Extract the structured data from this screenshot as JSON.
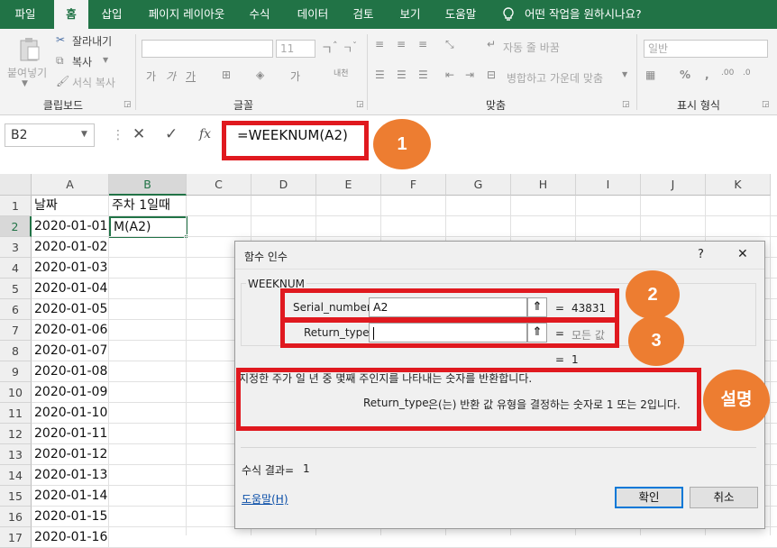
{
  "ribbon": {
    "tabs": [
      "파일",
      "홈",
      "삽입",
      "페이지 레이아웃",
      "수식",
      "데이터",
      "검토",
      "보기",
      "도움말"
    ],
    "active_tab": "홈",
    "tell_me": "어떤 작업을 원하시나요?",
    "clipboard": {
      "paste": "붙여넣기",
      "cut": "잘라내기",
      "copy": "복사",
      "format_painter": "서식 복사",
      "label": "클립보드"
    },
    "font": {
      "size": "11",
      "label": "글꼴"
    },
    "alignment": {
      "wrap_text": "자동 줄 바꿈",
      "merge_center": "병합하고 가운데 맞춤",
      "label": "맞춤"
    },
    "number": {
      "format": "일반",
      "label": "표시 형식"
    }
  },
  "formula_bar": {
    "name_box": "B2",
    "formula": "=WEEKNUM(A2)",
    "fx": "fx"
  },
  "sheet": {
    "columns": [
      "A",
      "B",
      "C",
      "D",
      "E",
      "F",
      "G",
      "H",
      "I",
      "J",
      "K"
    ],
    "rows": [
      "1",
      "2",
      "3",
      "4",
      "5",
      "6",
      "7",
      "8",
      "9",
      "10",
      "11",
      "12",
      "13",
      "14",
      "15",
      "16",
      "17"
    ],
    "a1": "날짜",
    "b1": "주차 1일때",
    "b2": "M(A2)",
    "dates": [
      "2020-01-01",
      "2020-01-02",
      "2020-01-03",
      "2020-01-04",
      "2020-01-05",
      "2020-01-06",
      "2020-01-07",
      "2020-01-08",
      "2020-01-09",
      "2020-01-10",
      "2020-01-11",
      "2020-01-12",
      "2020-01-13",
      "2020-01-14",
      "2020-01-15",
      "2020-01-16"
    ]
  },
  "dialog": {
    "title": "함수 인수",
    "help_q": "?",
    "close": "✕",
    "function_name": "WEEKNUM",
    "args": [
      {
        "label": "Serial_number",
        "value": "A2",
        "result": "43831"
      },
      {
        "label": "Return_type",
        "value": "",
        "result": "모든 값"
      }
    ],
    "eq": "=",
    "function_result": "1",
    "description": "지정한 주가 일 년 중 몇째 주인지를 나타내는 숫자를 반환합니다.",
    "arg_desc_name": "Return_type",
    "arg_desc": "은(는) 반환 값 유형을 결정하는 숫자로 1 또는 2입니다.",
    "formula_result_label": "수식 결과=",
    "formula_result": "1",
    "help_link": "도움말(H)",
    "ok": "확인",
    "cancel": "취소"
  },
  "annotations": {
    "b1": "1",
    "b2": "2",
    "b3": "3",
    "b4": "설명"
  },
  "colors": {
    "excel_green": "#217346",
    "annotation_red": "#e0191f",
    "bubble_orange": "#ed7d31"
  }
}
